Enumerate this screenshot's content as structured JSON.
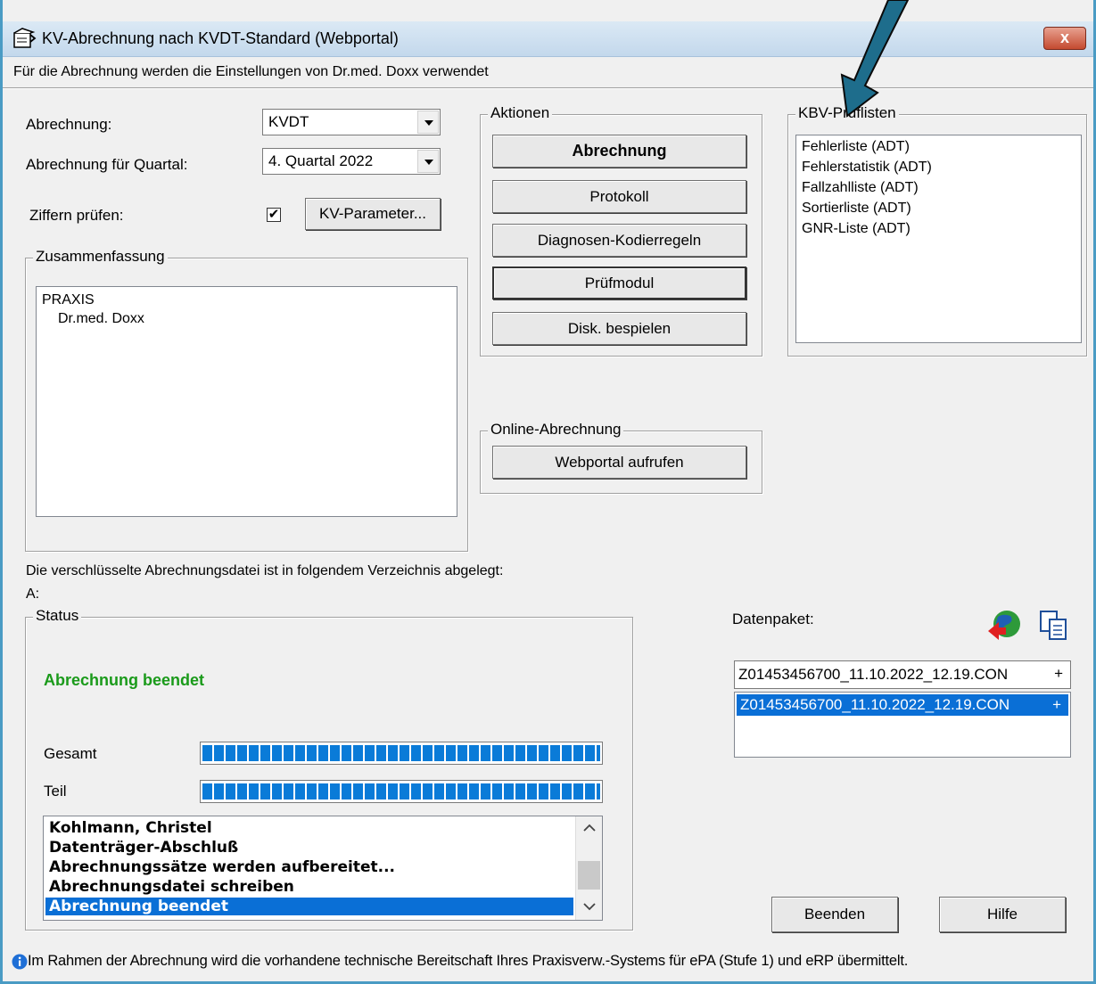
{
  "window": {
    "title": "KV-Abrechnung nach KVDT-Standard (Webportal)",
    "close_label": "x"
  },
  "info": "Für die Abrechnung werden die Einstellungen von Dr.med. Doxx verwendet",
  "settings": {
    "abrechnung_label": "Abrechnung:",
    "abrechnung_value": "KVDT",
    "quartal_label": "Abrechnung für Quartal:",
    "quartal_value": "4. Quartal 2022",
    "ziffern_label": "Ziffern prüfen:",
    "ziffern_checked": "✔",
    "kv_parameter_label": "KV-Parameter..."
  },
  "zusammenfassung": {
    "legend": "Zusammenfassung",
    "items": [
      "PRAXIS",
      "Dr.med. Doxx"
    ]
  },
  "aktionen": {
    "legend": "Aktionen",
    "abrechnung": "Abrechnung",
    "protokoll": "Protokoll",
    "diagnosen": "Diagnosen-Kodierregeln",
    "pruefmodul": "Prüfmodul",
    "disk": "Disk. bespielen"
  },
  "pruef": {
    "legend": "KBV-Prüflisten",
    "items": [
      "Fehlerliste (ADT)",
      "Fehlerstatistik (ADT)",
      "Fallzahlliste (ADT)",
      "Sortierliste (ADT)",
      "GNR-Liste (ADT)"
    ]
  },
  "online": {
    "legend": "Online-Abrechnung",
    "webportal": "Webportal aufrufen"
  },
  "directory": {
    "text": "Die verschlüsselte Abrechnungsdatei ist in folgendem Verzeichnis abgelegt:",
    "path": "A:"
  },
  "status": {
    "legend": "Status",
    "message": "Abrechnung beendet",
    "message_color": "#1a9a1a",
    "gesamt_label": "Gesamt",
    "gesamt_progress": 100,
    "teil_label": "Teil",
    "teil_progress": 100,
    "log": [
      "Kohlmann, Christel",
      "Datenträger-Abschluß",
      "Abrechnungssätze werden aufbereitet...",
      "Abrechnungsdatei schreiben",
      "Abrechnung beendet"
    ]
  },
  "datenpaket": {
    "label": "Datenpaket:",
    "items": [
      "Z01453456700_11.10.2022_12.19.CON",
      "Z01453456700_11.10.2022_12.19.CON"
    ],
    "plus": "+"
  },
  "buttons": {
    "beenden": "Beenden",
    "hilfe": "Hilfe"
  },
  "footer": {
    "text": "Im Rahmen der Abrechnung wird die vorhandene technische Bereitschaft Ihres Praxisverw.-Systems für ePA (Stufe 1) und eRP übermittelt."
  },
  "colors": {
    "accent": "#0a6fd6",
    "annotation_arrow": "#1e6d8c"
  }
}
